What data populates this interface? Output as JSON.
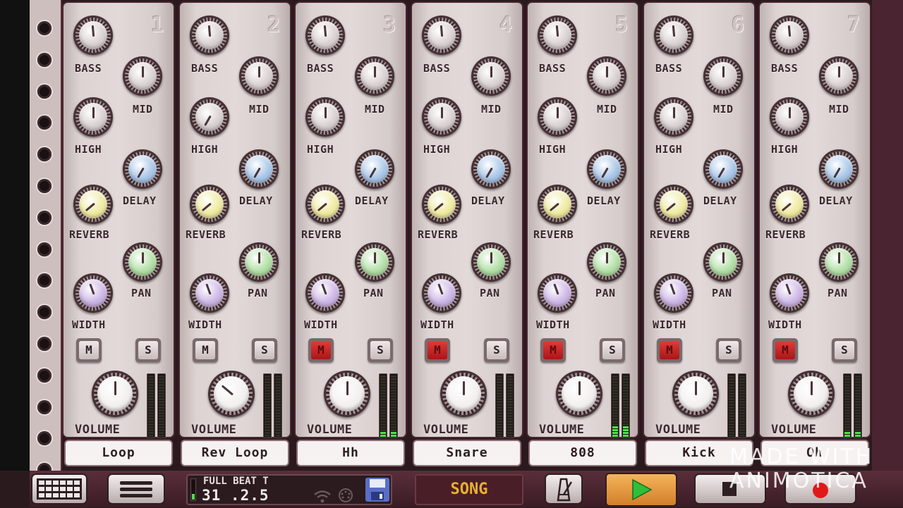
{
  "labels": {
    "bass": "BASS",
    "mid": "MID",
    "high": "HIGH",
    "delay": "DELAY",
    "reverb": "REVERB",
    "pan": "PAN",
    "width": "WIDTH",
    "volume": "VOLUME",
    "mute": "M",
    "solo": "S"
  },
  "colors": {
    "knob_gray": "#d9d0d0",
    "knob_blue": "#a9c6e8",
    "knob_yellow": "#efeaa0",
    "knob_green": "#b2dfa6",
    "knob_purple": "#cdb6e6",
    "knob_white": "#f2eeee",
    "mute_active": "#d42a2a",
    "song_text": "#e8b030",
    "play_green": "#2fbf3a",
    "record_red": "#e01a1a"
  },
  "channels": [
    {
      "number": "1",
      "name": "Loop",
      "muted": false
    },
    {
      "number": "2",
      "name": "Rev Loop",
      "muted": false
    },
    {
      "number": "3",
      "name": "Hh",
      "muted": true
    },
    {
      "number": "4",
      "name": "Snare",
      "muted": true
    },
    {
      "number": "5",
      "name": "808",
      "muted": true
    },
    {
      "number": "6",
      "name": "Kick",
      "muted": true
    },
    {
      "number": "7",
      "name": "Oh",
      "muted": true
    }
  ],
  "transport": {
    "display_title": "FULL BEAT T",
    "position": "31 .2.5",
    "song_label": "SONG",
    "icons": [
      "grid-icon",
      "menu-icon",
      "wifi-icon",
      "midi-icon",
      "save-icon",
      "metronome-icon",
      "play-icon",
      "stop-icon",
      "record-icon"
    ]
  },
  "watermark": {
    "line1": "MADE WITH",
    "line2": "ANIMOTICA"
  }
}
